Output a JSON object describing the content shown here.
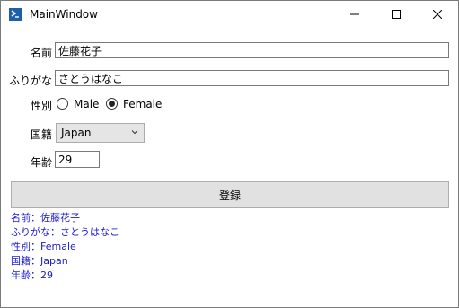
{
  "window": {
    "title": "MainWindow"
  },
  "form": {
    "name_label": "名前",
    "name_value": "佐藤花子",
    "furigana_label": "ふりがな",
    "furigana_value": "さとうはなこ",
    "gender_label": "性別",
    "gender_options": [
      "Male",
      "Female"
    ],
    "gender_selected": "Female",
    "nationality_label": "国籍",
    "nationality_value": "Japan",
    "age_label": "年齢",
    "age_value": "29",
    "submit_label": "登録"
  },
  "output": [
    "名前：佐藤花子",
    "ふりがな：さとうはなこ",
    "性別：Female",
    "国籍：Japan",
    "年齢：29"
  ],
  "colors": {
    "output_text": "#1c1ccc",
    "button_bg": "#e1e1e1"
  },
  "icons": [
    "app-icon",
    "minimize-icon",
    "maximize-icon",
    "close-icon",
    "chevron-down-icon"
  ]
}
